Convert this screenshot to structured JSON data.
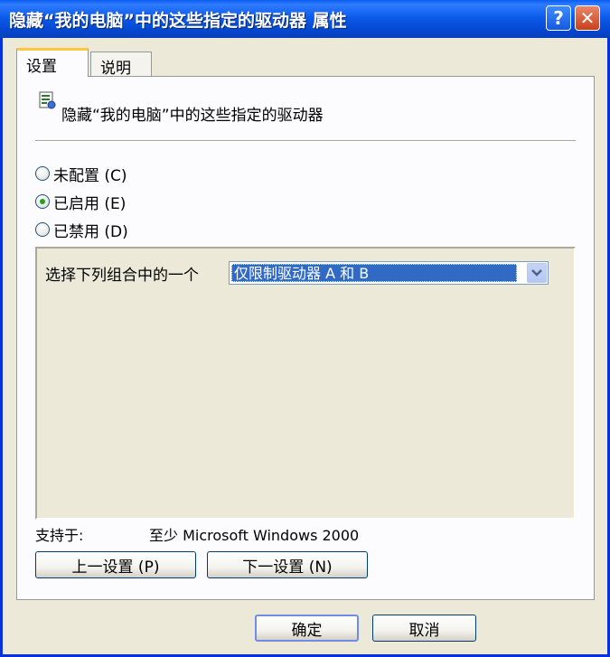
{
  "window": {
    "title": "隐藏“我的电脑”中的这些指定的驱动器 属性"
  },
  "titlebar": {
    "help_label": "?",
    "close_label": "✕"
  },
  "tabs": [
    {
      "label": "设置",
      "active": true
    },
    {
      "label": "说明",
      "active": false
    }
  ],
  "policy": {
    "title": "隐藏“我的电脑”中的这些指定的驱动器"
  },
  "radios": [
    {
      "label": "未配置 (C)",
      "checked": false
    },
    {
      "label": "已启用 (E)",
      "checked": true
    },
    {
      "label": "已禁用 (D)",
      "checked": false
    }
  ],
  "options": {
    "select_label": "选择下列组合中的一个",
    "select_value": "仅限制驱动器 A 和 B"
  },
  "support": {
    "label": "支持于:",
    "value": "至少 Microsoft Windows 2000"
  },
  "nav": {
    "prev_label": "上一设置 (P)",
    "next_label": "下一设置 (N)"
  },
  "dialog": {
    "ok_label": "确定",
    "cancel_label": "取消"
  },
  "colors": {
    "titlebar": "#0a5cf0",
    "selection": "#316ac5",
    "face": "#ece9d8"
  }
}
